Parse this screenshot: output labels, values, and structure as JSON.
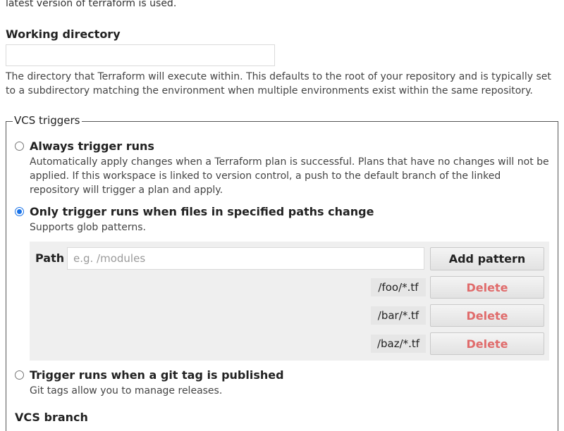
{
  "intro_text": "latest version of terraform is used.",
  "working_directory": {
    "label": "Working directory",
    "value": "",
    "help": "The directory that Terraform will execute within. This defaults to the root of your repository and is typically set to a subdirectory matching the environment when multiple environments exist within the same repository."
  },
  "vcs_triggers": {
    "legend": "VCS triggers",
    "options": [
      {
        "title": "Always trigger runs",
        "description": "Automatically apply changes when a Terraform plan is successful. Plans that have no changes will not be applied. If this workspace is linked to version control, a push to the default branch of the linked repository will trigger a plan and apply.",
        "selected": false
      },
      {
        "title": "Only trigger runs when files in specified paths change",
        "description": "Supports glob patterns.",
        "selected": true
      },
      {
        "title": "Trigger runs when a git tag is published",
        "description": "Git tags allow you to manage releases.",
        "selected": false
      }
    ],
    "paths": {
      "label": "Path",
      "placeholder": "e.g. /modules",
      "value": "",
      "add_button": "Add pattern",
      "delete_label": "Delete",
      "patterns": [
        "/foo/*.tf",
        "/bar/*.tf",
        "/baz/*.tf"
      ]
    }
  },
  "vcs_branch": {
    "label": "VCS branch"
  },
  "colors": {
    "radio_selected": "#1a73e8",
    "delete_text": "#e06b6b",
    "paths_background": "#efefef"
  }
}
